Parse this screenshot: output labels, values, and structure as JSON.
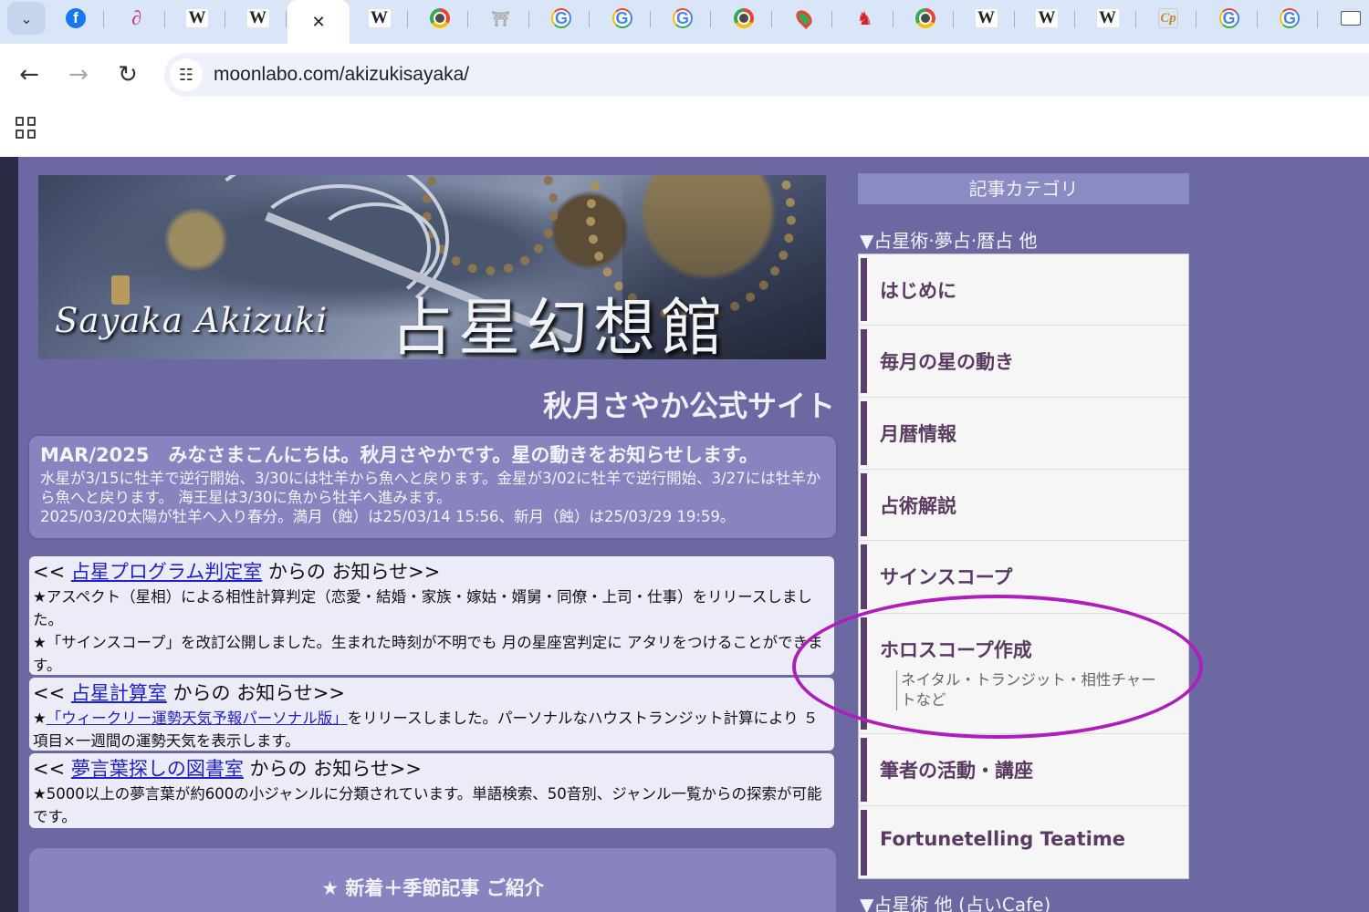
{
  "browser": {
    "tabs": [
      {
        "icon": "facebook-icon",
        "glyph": "f",
        "cls": "fav-fb"
      },
      {
        "icon": "swirl-logo-icon",
        "glyph": "∂",
        "cls": "fav-sp"
      },
      {
        "icon": "wikipedia-icon",
        "glyph": "W",
        "cls": "fav-w"
      },
      {
        "icon": "wikipedia-icon",
        "glyph": "W",
        "cls": "fav-w"
      },
      {
        "icon": "close-icon",
        "glyph": "✕",
        "cls": "active"
      },
      {
        "icon": "wikipedia-icon",
        "glyph": "W",
        "cls": "fav-w"
      },
      {
        "icon": "chrome-icon",
        "glyph": "",
        "cls": "fav-chrome"
      },
      {
        "icon": "shrine-logo-icon",
        "glyph": "⛩",
        "cls": "fav-taisha"
      },
      {
        "icon": "google-icon",
        "glyph": "G",
        "cls": "fav-g"
      },
      {
        "icon": "google-icon",
        "glyph": "G",
        "cls": "fav-g"
      },
      {
        "icon": "google-icon",
        "glyph": "G",
        "cls": "fav-g"
      },
      {
        "icon": "chrome-icon",
        "glyph": "",
        "cls": "fav-chrome"
      },
      {
        "icon": "google-maps-icon",
        "glyph": "",
        "cls": "fav-map"
      },
      {
        "icon": "horse-logo-icon",
        "glyph": "♞",
        "cls": "fav-horse"
      },
      {
        "icon": "chrome-icon",
        "glyph": "",
        "cls": "fav-chrome"
      },
      {
        "icon": "wikipedia-icon",
        "glyph": "W",
        "cls": "fav-w"
      },
      {
        "icon": "wikipedia-icon",
        "glyph": "W",
        "cls": "fav-w"
      },
      {
        "icon": "wikipedia-icon",
        "glyph": "W",
        "cls": "fav-w"
      },
      {
        "icon": "cp-logo-icon",
        "glyph": "Cp",
        "cls": "fav-cp"
      },
      {
        "icon": "google-icon",
        "glyph": "G",
        "cls": "fav-g"
      },
      {
        "icon": "google-icon",
        "glyph": "G",
        "cls": "fav-g"
      },
      {
        "icon": "site-logo-icon",
        "glyph": "",
        "cls": "fav-box"
      }
    ],
    "url": "moonlabo.com/akizukisayaka/"
  },
  "header": {
    "name_en": "Sayaka Akizuki",
    "name_jp": "占星幻想館"
  },
  "site_title": "秋月さやか公式サイト",
  "notice": {
    "title": "MAR/2025　みなさまこんにちは。秋月さやかです。星の動きをお知らせします。",
    "line1": "水星が3/15に牡羊で逆行開始、3/30には牡羊から魚へと戻ります。金星が3/02に牡羊で逆行開始、3/27には牡羊から魚へと戻ります。 海王星は3/30に魚から牡羊へ進みます。",
    "line2": "2025/03/20太陽が牡羊へ入り春分。満月（蝕）は25/03/14 15:56、新月（蝕）は25/03/29 19:59。"
  },
  "news": [
    {
      "prefix": "<< ",
      "link": "占星プログラム判定室",
      "suffix": " からの お知らせ>>",
      "text1": "★アスペクト（星相）による相性計算判定（恋愛・結婚・家族・嫁姑・婿舅・同僚・上司・仕事）をリリースしました。",
      "text2": "★「サインスコープ」を改訂公開しました。生まれた時刻が不明でも 月の星座宮判定に アタリをつけることができます。"
    },
    {
      "prefix": "<< ",
      "link": "占星計算室",
      "suffix": " からの お知らせ>>",
      "star": "★",
      "inline_link": "「ウィークリー運勢天気予報パーソナル版」",
      "text1": "をリリースしました。パーソナルなハウストランジット計算により ５項目×一週間の運勢天気を表示します。"
    },
    {
      "prefix": "<< ",
      "link": "夢言葉探しの図書室",
      "suffix": " からの お知らせ>>",
      "text1": "★5000以上の夢言葉が約600の小ジャンルに分類されています。単語検索、50音別、ジャンル一覧からの探索が可能です。"
    }
  ],
  "featured_title": "★ 新着＋季節記事 ご紹介",
  "sidebar": {
    "header": "記事カテゴリ",
    "section1": "▼占星術·夢占·暦占 他",
    "items": [
      {
        "label": "はじめに"
      },
      {
        "label": "毎月の星の動き"
      },
      {
        "label": "月暦情報"
      },
      {
        "label": "占術解説"
      },
      {
        "label": "サインスコープ"
      },
      {
        "label": "ホロスコープ作成",
        "sub": "ネイタル・トランジット・相性チャートなど"
      },
      {
        "label": "筆者の活動・講座"
      },
      {
        "label": "Fortunetelling Teatime"
      }
    ],
    "section2": "▼占星術 他 (占いCafe)"
  }
}
